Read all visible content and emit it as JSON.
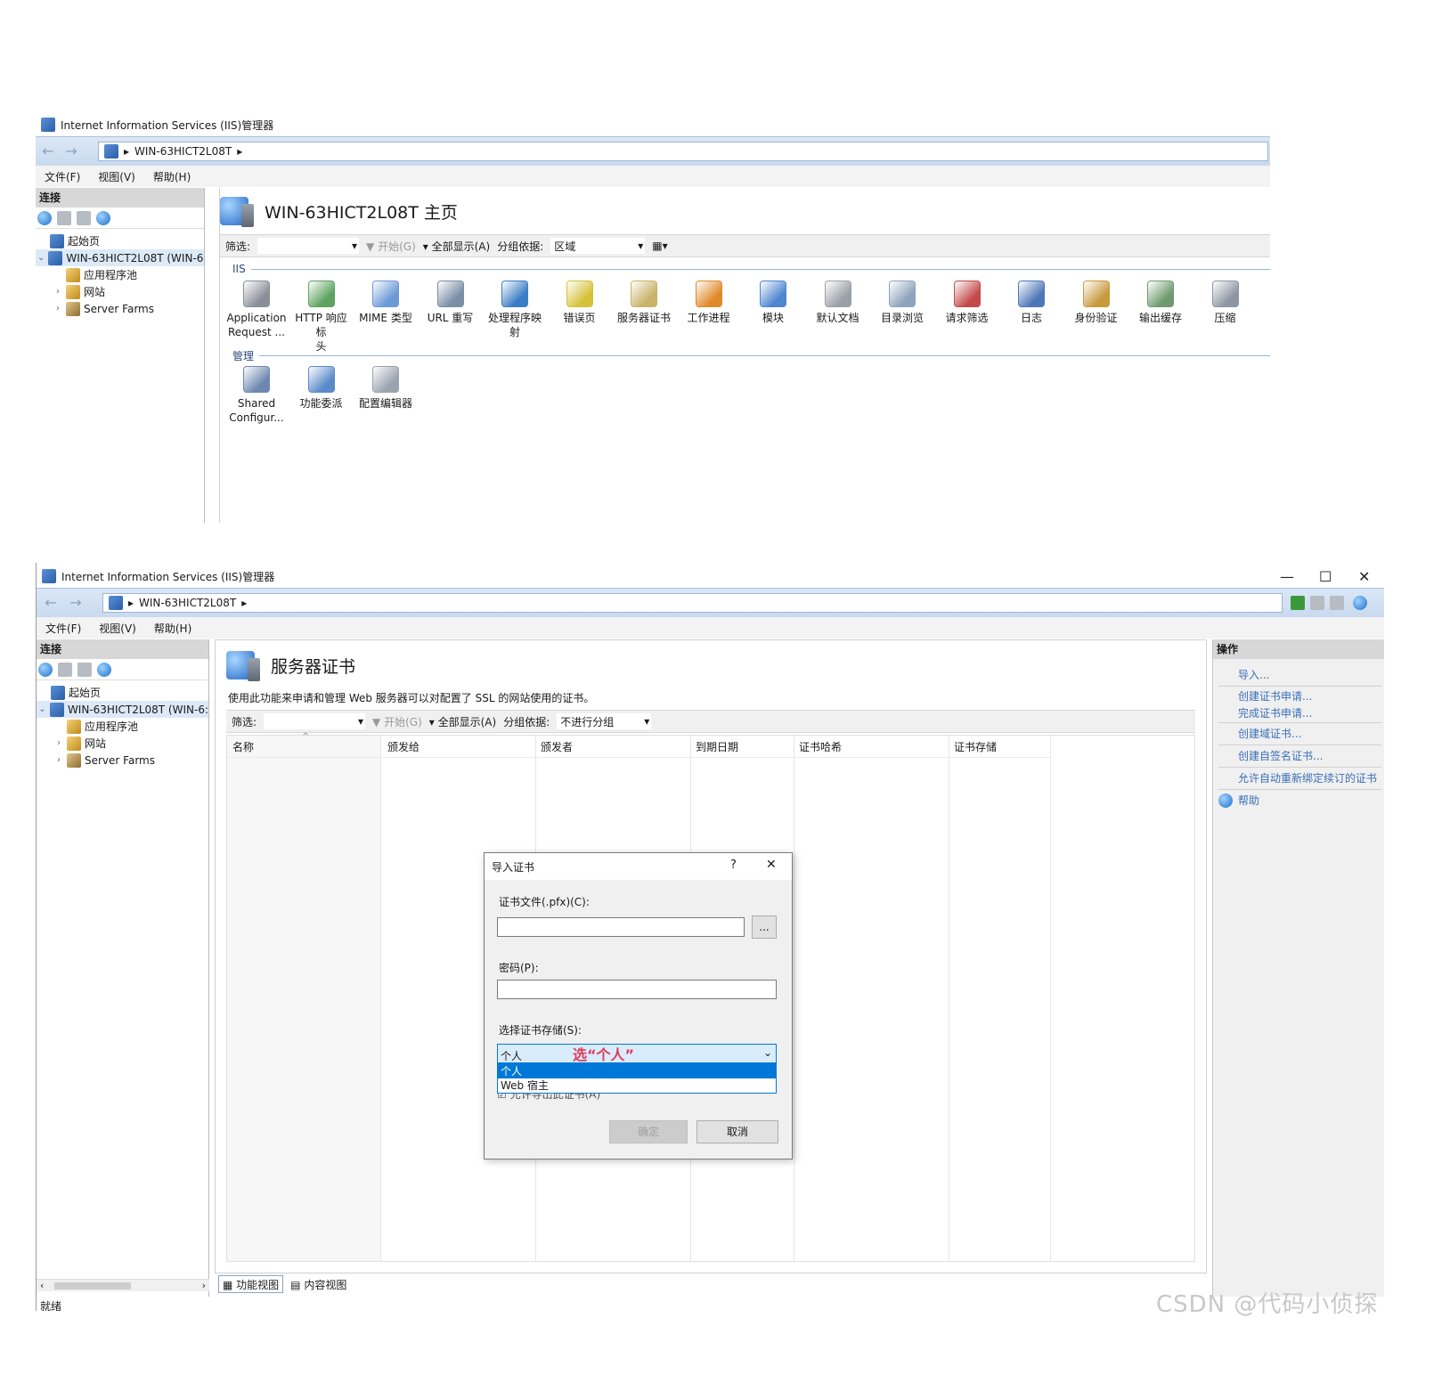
{
  "window1": {
    "title": "Internet Information Services (IIS)管理器",
    "address": "WIN-63HICT2L08T",
    "menu": [
      "文件(F)",
      "视图(V)",
      "帮助(H)"
    ],
    "connections_header": "连接",
    "tree": [
      {
        "label": "起始页"
      },
      {
        "label": "WIN-63HICT2L08T (WIN-6:"
      },
      {
        "label": "应用程序池"
      },
      {
        "label": "网站"
      },
      {
        "label": "Server Farms"
      }
    ],
    "page_title": "WIN-63HICT2L08T 主页",
    "filter": {
      "label": "筛选:",
      "go": "开始(G)",
      "show_all": "全部显示(A)",
      "group_label": "分组依据:",
      "group_value": "区域"
    },
    "section_iis": "IIS",
    "iis_features": [
      {
        "line1": "Application",
        "line2": "Request ...",
        "color": "#8a8f99"
      },
      {
        "line1": "HTTP 响应标",
        "line2": "头",
        "color": "#5da35f"
      },
      {
        "line1": "MIME 类型",
        "line2": "",
        "color": "#6b9ad6"
      },
      {
        "line1": "URL 重写",
        "line2": "",
        "color": "#7a8ea6"
      },
      {
        "line1": "处理程序映",
        "line2": "射",
        "color": "#3b7dc4"
      },
      {
        "line1": "错误页",
        "line2": "",
        "color": "#d6c23a"
      },
      {
        "line1": "服务器证书",
        "line2": "",
        "color": "#c9b36a"
      },
      {
        "line1": "工作进程",
        "line2": "",
        "color": "#e08a2a"
      },
      {
        "line1": "模块",
        "line2": "",
        "color": "#4f86d0"
      },
      {
        "line1": "默认文档",
        "line2": "",
        "color": "#9aa0a8"
      },
      {
        "line1": "目录浏览",
        "line2": "",
        "color": "#8ea3bd"
      },
      {
        "line1": "请求筛选",
        "line2": "",
        "color": "#c44a4a"
      },
      {
        "line1": "日志",
        "line2": "",
        "color": "#4e77b8"
      },
      {
        "line1": "身份验证",
        "line2": "",
        "color": "#c89a3e"
      },
      {
        "line1": "输出缓存",
        "line2": "",
        "color": "#6f9a6f"
      },
      {
        "line1": "压缩",
        "line2": "",
        "color": "#8d96a3"
      }
    ],
    "section_manage": "管理",
    "manage_features": [
      {
        "line1": "Shared",
        "line2": "Configur...",
        "color": "#6e87b0"
      },
      {
        "line1": "功能委派",
        "line2": "",
        "color": "#5b8ac9"
      },
      {
        "line1": "配置编辑器",
        "line2": "",
        "color": "#9aa3ae"
      }
    ]
  },
  "window2": {
    "title": "Internet Information Services (IIS)管理器",
    "address": "WIN-63HICT2L08T",
    "menu": [
      "文件(F)",
      "视图(V)",
      "帮助(H)"
    ],
    "connections_header": "连接",
    "tree": [
      {
        "label": "起始页"
      },
      {
        "label": "WIN-63HICT2L08T (WIN-6:"
      },
      {
        "label": "应用程序池"
      },
      {
        "label": "网站"
      },
      {
        "label": "Server Farms"
      }
    ],
    "page_title": "服务器证书",
    "description": "使用此功能来申请和管理 Web 服务器可以对配置了 SSL 的网站使用的证书。",
    "filter": {
      "label": "筛选:",
      "go": "开始(G)",
      "show_all": "全部显示(A)",
      "group_label": "分组依据:",
      "group_value": "不进行分组"
    },
    "columns": [
      "名称",
      "颁发给",
      "颁发者",
      "到期日期",
      "证书哈希",
      "证书存储"
    ],
    "actions_header": "操作",
    "actions": [
      "导入...",
      "创建证书申请...",
      "完成证书申请...",
      "创建域证书...",
      "创建自签名证书...",
      "允许自动重新绑定续订的证书",
      "帮助"
    ],
    "bottom_tabs": [
      "功能视图",
      "内容视图"
    ],
    "status": "就绪",
    "window_controls": {
      "minimize": "—",
      "maximize": "☐",
      "close": "✕"
    }
  },
  "dialog": {
    "title": "导入证书",
    "help": "?",
    "close": "✕",
    "cert_file_label": "证书文件(.pfx)(C):",
    "cert_file_value": "",
    "browse": "...",
    "password_label": "密码(P):",
    "password_value": "",
    "store_label": "选择证书存储(S):",
    "store_value": "个人",
    "annotation": "选“个人”",
    "options": [
      "个人",
      "Web 宿主"
    ],
    "export_checkbox": "允许导出此证书(A)",
    "ok": "确定",
    "cancel": "取消"
  },
  "watermark": "CSDN @代码小侦探"
}
